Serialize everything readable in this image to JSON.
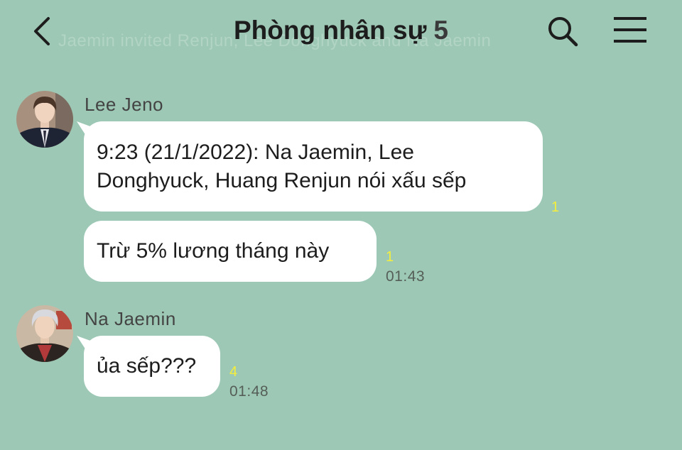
{
  "header": {
    "ghost_text": "Jaemin invited Renjun, Lee Donghyuck and Na Jaemin",
    "title": "Phòng nhân sự",
    "member_count": "5"
  },
  "icons": {
    "back": "chevron-left-icon",
    "search": "search-icon",
    "menu": "hamburger-menu-icon"
  },
  "colors": {
    "background": "#9dc8b5",
    "bubble": "#ffffff",
    "read_count": "#f5ee3a"
  },
  "messages": [
    {
      "sender": "Lee Jeno",
      "bubbles": [
        {
          "line1": "9:23 (21/1/2022): Na Jaemin, Lee",
          "line2": "Donghyuck, Huang Renjun nói xấu sếp",
          "read_count": "1"
        },
        {
          "text": "Trừ 5% lương tháng này",
          "read_count": "1",
          "time": "01:43"
        }
      ]
    },
    {
      "sender": "Na Jaemin",
      "bubbles": [
        {
          "text": "ủa sếp???",
          "read_count": "4",
          "time": "01:48"
        }
      ]
    }
  ]
}
